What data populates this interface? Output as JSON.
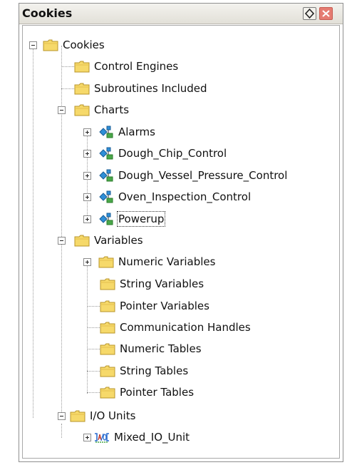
{
  "panel": {
    "title": "Cookies",
    "pin_icon": "pin-icon",
    "close_icon": "close-icon"
  },
  "tree": {
    "root": "Cookies",
    "control_engines": "Control Engines",
    "subroutines": "Subroutines Included",
    "charts": {
      "label": "Charts",
      "items": [
        "Alarms",
        "Dough_Chip_Control",
        "Dough_Vessel_Pressure_Control",
        "Oven_Inspection_Control",
        "Powerup"
      ]
    },
    "variables": {
      "label": "Variables",
      "items": [
        "Numeric Variables",
        "String Variables",
        "Pointer Variables",
        "Communication Handles",
        "Numeric Tables",
        "String Tables",
        "Pointer Tables"
      ]
    },
    "io_units": {
      "label": "I/O Units",
      "items": [
        "Mixed_IO_Unit"
      ]
    }
  },
  "colors": {
    "folder": "#f6d96a",
    "folder_outline": "#b8952a",
    "chart_icon_blue": "#2f8fd8",
    "chart_icon_green": "#4aa84a",
    "io_icon_blue": "#2a6cd0"
  }
}
